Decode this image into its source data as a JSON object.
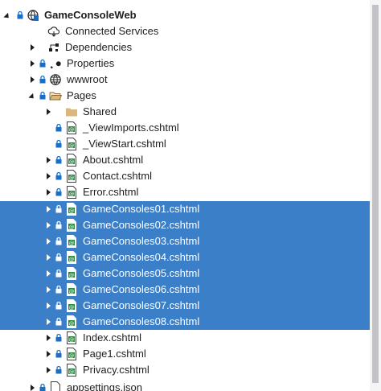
{
  "tree": {
    "root": "GameConsoleWeb",
    "connected_services": "Connected Services",
    "dependencies": "Dependencies",
    "properties": "Properties",
    "wwwroot": "wwwroot",
    "pages": "Pages",
    "shared": "Shared",
    "viewimports": "_ViewImports.cshtml",
    "viewstart": "_ViewStart.cshtml",
    "about": "About.cshtml",
    "contact": "Contact.cshtml",
    "error": "Error.cshtml",
    "gc01": "GameConsoles01.cshtml",
    "gc02": "GameConsoles02.cshtml",
    "gc03": "GameConsoles03.cshtml",
    "gc04": "GameConsoles04.cshtml",
    "gc05": "GameConsoles05.cshtml",
    "gc06": "GameConsoles06.cshtml",
    "gc07": "GameConsoles07.cshtml",
    "gc08": "GameConsoles08.cshtml",
    "index": "Index.cshtml",
    "page1": "Page1.cshtml",
    "privacy": "Privacy.cshtml",
    "appsettings": "appsettings.json"
  },
  "icons": {
    "project": "web-project-icon",
    "connected": "cloud-connected-icon",
    "dependencies": "dependencies-icon",
    "properties": "wrench-icon",
    "wwwroot": "globe-icon",
    "folder": "folder-icon",
    "file": "razor-file-icon",
    "lock": "lock-icon"
  },
  "colors": {
    "selection": "#3c7fc9",
    "lock": "#1a6fc4",
    "folder": "#dcb67a",
    "file_green": "#2f8a43"
  }
}
